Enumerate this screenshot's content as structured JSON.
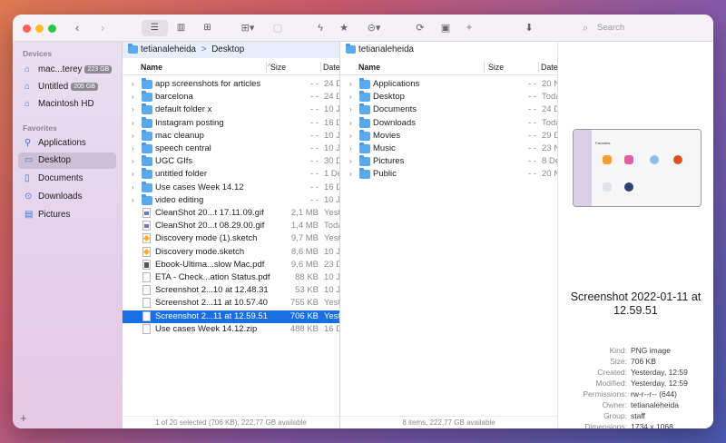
{
  "colors": {
    "accent": "#1a6fe0",
    "folder": "#5aaaf0",
    "red": "#fe5f57",
    "yellow": "#febc2e",
    "green": "#28c840"
  },
  "toolbar": {
    "search_placeholder": "Search",
    "back_icon": "chevron-left-icon",
    "forward_icon": "chevron-right-icon"
  },
  "sidebar": {
    "devices_header": "Devices",
    "devices": [
      {
        "label": "mac...terey",
        "badge": "223 GB"
      },
      {
        "label": "Untitled",
        "badge": "205 GB"
      },
      {
        "label": "Macintosh HD",
        "badge": ""
      }
    ],
    "favorites_header": "Favorites",
    "favorites": [
      {
        "label": "Applications",
        "icon": "apps-icon"
      },
      {
        "label": "Desktop",
        "icon": "desktop-icon"
      },
      {
        "label": "Documents",
        "icon": "document-icon"
      },
      {
        "label": "Downloads",
        "icon": "download-icon"
      },
      {
        "label": "Pictures",
        "icon": "pictures-icon"
      }
    ]
  },
  "pane1": {
    "path_root": "tetianaleheida",
    "path_sep": ">",
    "path_leaf": "Desktop",
    "col_name": "Name",
    "col_size": "Size",
    "col_date": "Date",
    "rows": [
      {
        "name": "app screenshots for articles",
        "size": "- -",
        "date": "24 D",
        "kind": "folder"
      },
      {
        "name": "barcelona",
        "size": "- -",
        "date": "24 D",
        "kind": "folder"
      },
      {
        "name": "default folder x",
        "size": "- -",
        "date": "10 J",
        "kind": "folder"
      },
      {
        "name": "Instagram posting",
        "size": "- -",
        "date": "16 D",
        "kind": "folder"
      },
      {
        "name": "mac cleanup",
        "size": "- -",
        "date": "10 J",
        "kind": "folder"
      },
      {
        "name": "speech central",
        "size": "- -",
        "date": "10 J",
        "kind": "folder"
      },
      {
        "name": "UGC GIfs",
        "size": "- -",
        "date": "30 D",
        "kind": "folder"
      },
      {
        "name": "untitled folder",
        "size": "- -",
        "date": "1 De",
        "kind": "folder"
      },
      {
        "name": "Use cases Week 14.12",
        "size": "- -",
        "date": "16 D",
        "kind": "folder"
      },
      {
        "name": "video editing",
        "size": "- -",
        "date": "10 J",
        "kind": "folder"
      },
      {
        "name": "CleanShot 20...t 17.11.09.gif",
        "size": "2,1 MB",
        "date": "Yest",
        "kind": "img"
      },
      {
        "name": "CleanShot 20...t 08.29.00.gif",
        "size": "1,4 MB",
        "date": "Toda",
        "kind": "img"
      },
      {
        "name": "Discovery mode (1).sketch",
        "size": "9,7 MB",
        "date": "Yest",
        "kind": "sketch"
      },
      {
        "name": "Discovery mode.sketch",
        "size": "8,6 MB",
        "date": "10 J",
        "kind": "sketch"
      },
      {
        "name": "Ebook-Ultima...slow Mac.pdf",
        "size": "9,6 MB",
        "date": "23 D",
        "kind": "pdf"
      },
      {
        "name": "ETA - Check...ation Status.pdf",
        "size": "88 KB",
        "date": "10 J",
        "kind": "file"
      },
      {
        "name": "Screenshot 2...10 at 12.48.31",
        "size": "53 KB",
        "date": "10 J",
        "kind": "file"
      },
      {
        "name": "Screenshot 2...11 at 10.57.40",
        "size": "755 KB",
        "date": "Yest",
        "kind": "file"
      },
      {
        "name": "Screenshot 2...11 at 12.59.51",
        "size": "706 KB",
        "date": "Yest",
        "kind": "file",
        "selected": true
      },
      {
        "name": "Use cases Week 14.12.zip",
        "size": "488 KB",
        "date": "16 D",
        "kind": "file"
      }
    ],
    "footer": "1 of 20 selected (706 KB), 222,77 GB available"
  },
  "pane2": {
    "path_root": "tetianaleheida",
    "col_name": "Name",
    "col_size": "Size",
    "col_date": "Date",
    "rows": [
      {
        "name": "Applications",
        "size": "- -",
        "date": "20 N"
      },
      {
        "name": "Desktop",
        "size": "- -",
        "date": "Toda"
      },
      {
        "name": "Documents",
        "size": "- -",
        "date": "24 D"
      },
      {
        "name": "Downloads",
        "size": "- -",
        "date": "Toda"
      },
      {
        "name": "Movies",
        "size": "- -",
        "date": "29 D"
      },
      {
        "name": "Music",
        "size": "- -",
        "date": "23 N"
      },
      {
        "name": "Pictures",
        "size": "- -",
        "date": "8 De"
      },
      {
        "name": "Public",
        "size": "- -",
        "date": "20 N"
      }
    ],
    "footer": "8 items, 222,77 GB available"
  },
  "preview": {
    "thumb_label": "Favorites",
    "title": "Screenshot 2022-01-11 at 12.59.51",
    "meta": [
      {
        "k": "Kind:",
        "v": "PNG image"
      },
      {
        "k": "Size:",
        "v": "706 KB"
      },
      {
        "k": "Created:",
        "v": "Yesterday, 12:59"
      },
      {
        "k": "Modified:",
        "v": "Yesterday, 12:59"
      },
      {
        "k": "Permissions:",
        "v": "rw-r--r-- (644)"
      },
      {
        "k": "Owner:",
        "v": "tetianaleheida"
      },
      {
        "k": "Group:",
        "v": "staff"
      },
      {
        "k": "Dimensions:",
        "v": "1734 x 1068"
      }
    ]
  }
}
